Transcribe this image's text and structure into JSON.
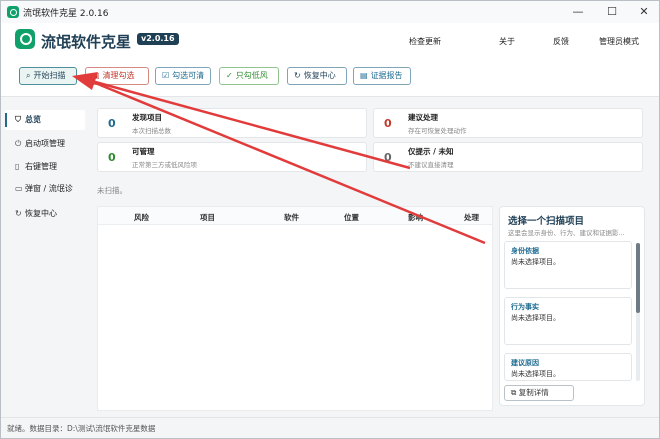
{
  "titlebar": {
    "title": "流氓软件克星 2.0.16",
    "minimize": "—",
    "maximize": "☐",
    "close": "✕"
  },
  "header": {
    "app_name": "流氓软件克星",
    "version": "v2.0.16",
    "links": [
      "检查更新",
      "关于",
      "反馈",
      "管理员模式"
    ]
  },
  "toolbar": {
    "scan": "开始扫描",
    "clear": "清理勾选",
    "check_cleanable": "勾选可清",
    "low_risk": "只勾低风",
    "recovery": "恢复中心",
    "report": "证据报告"
  },
  "sidebar": {
    "items": [
      {
        "label": "总览",
        "icon": "shield-icon"
      },
      {
        "label": "启动项管理",
        "icon": "power-icon"
      },
      {
        "label": "右键管理",
        "icon": "mouse-icon"
      },
      {
        "label": "弹窗 / 流氓诊",
        "icon": "window-icon"
      },
      {
        "label": "恢复中心",
        "icon": "restore-icon"
      }
    ]
  },
  "stats": [
    {
      "num": "0",
      "title": "发现项目",
      "sub": "本次扫描总数",
      "color": "#1e6b91"
    },
    {
      "num": "0",
      "title": "建议处理",
      "sub": "存在可恢复处理动作",
      "color": "#c0392b"
    },
    {
      "num": "0",
      "title": "可管理",
      "sub": "正常第三方或低风险项",
      "color": "#2e8b2e"
    },
    {
      "num": "0",
      "title": "仅提示 / 未知",
      "sub": "不建议直接清理",
      "color": "#666666"
    }
  ],
  "status_line": "未扫描。",
  "table": {
    "columns": [
      "风险",
      "项目",
      "软件",
      "位置",
      "影响",
      "处理"
    ]
  },
  "detail": {
    "title": "选择一个扫描项目",
    "subtitle": "这里会显示身份、行为、建议和证据影...",
    "sections": [
      {
        "label": "身份依据",
        "text": "尚未选择项目。"
      },
      {
        "label": "行为事实",
        "text": "尚未选择项目。"
      },
      {
        "label": "建议原因",
        "text": "尚未选择项目。"
      }
    ],
    "copy": "复制详情"
  },
  "statusbar": "就绪。数据目录：D:\\测试\\流氓软件克星数据",
  "colors": {
    "accent": "#1e6b91",
    "brand": "#10a06a",
    "danger": "#c0392b",
    "arrow": "#e23b3b"
  }
}
